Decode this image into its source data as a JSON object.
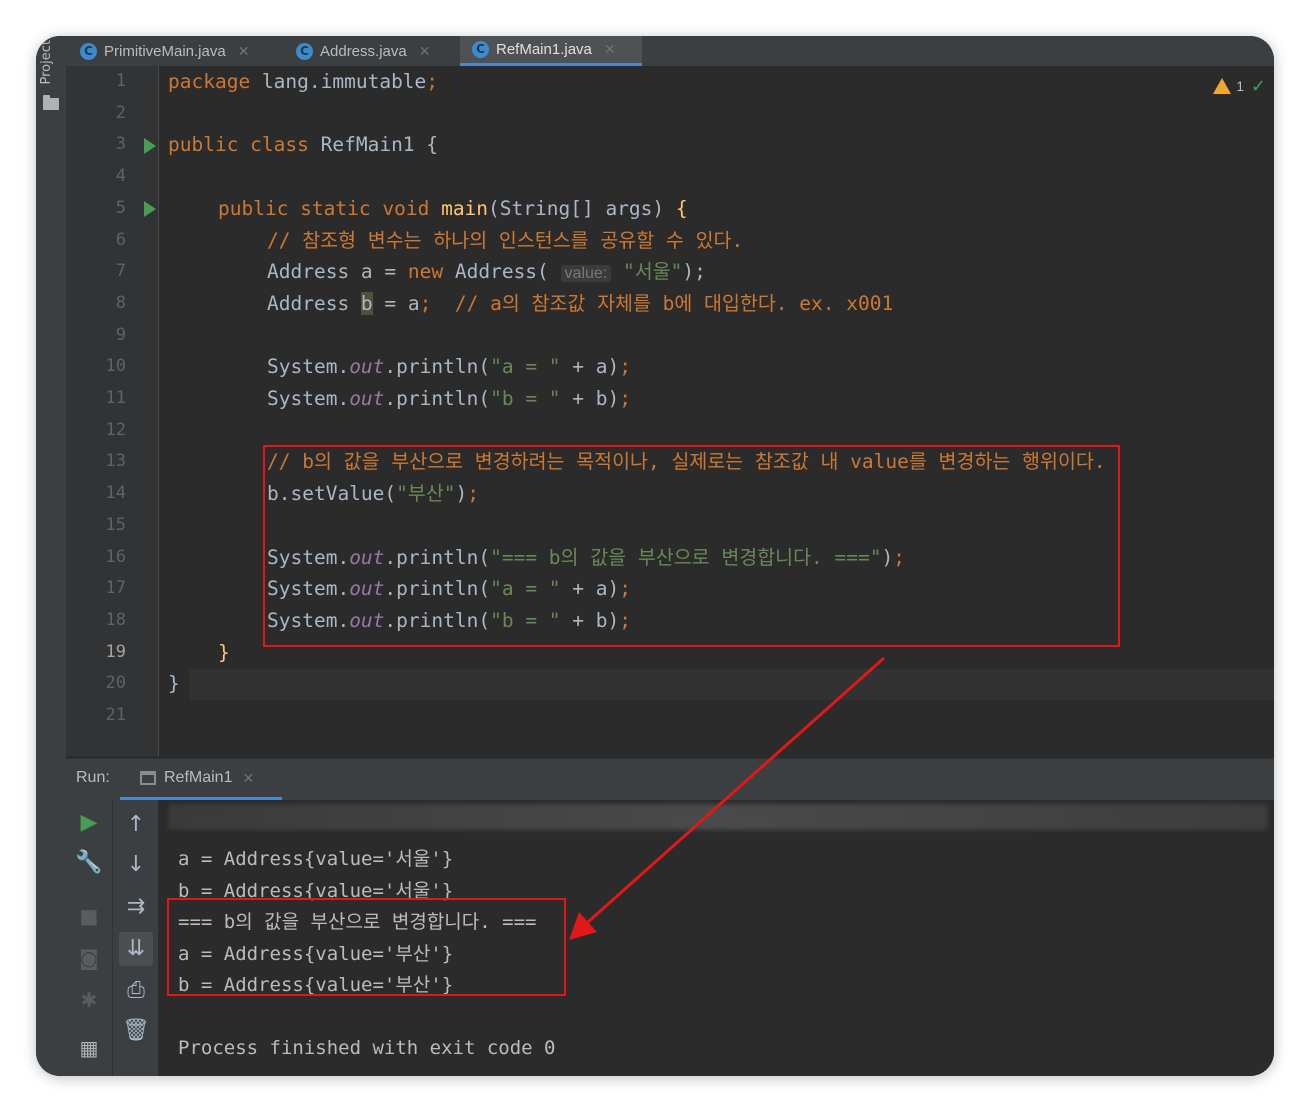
{
  "tabs": [
    {
      "label": "PrimitiveMain.java",
      "active": false
    },
    {
      "label": "Address.java",
      "active": false
    },
    {
      "label": "RefMain1.java",
      "active": true
    }
  ],
  "project_label": "Project",
  "inspection": {
    "warnings": "1"
  },
  "line_numbers": [
    "1",
    "2",
    "3",
    "4",
    "5",
    "6",
    "7",
    "8",
    "9",
    "10",
    "11",
    "12",
    "13",
    "14",
    "15",
    "16",
    "17",
    "18",
    "19",
    "20",
    "21"
  ],
  "current_line": "19",
  "code": {
    "l1_kw": "package",
    "l1_rest": " lang.immutable",
    "l1_semi": ";",
    "l3_kw": "public class",
    "l3_rest": " RefMain1 {",
    "l5_kw": "public static void",
    "l5_fn": "main",
    "l5_args": "(String[] args) ",
    "l5_brace": "{",
    "l6_comment": "// 참조형 변수는 하나의 인스턴스를 공유할 수 있다.",
    "l7_a": "Address a = ",
    "l7_new": "new",
    "l7_b": " Address(",
    "l7_hint": "value:",
    "l7_str": "\"서울\"",
    "l7_c": ");",
    "l8_a": "Address ",
    "l8_b": "b",
    "l8_c": " = a",
    "l8_semi": ";",
    "l8_comment": "  // a의 참조값 자체를 b에 대입한다. ex. x001",
    "l10_a": "System.",
    "l10_out": "out",
    "l10_b": ".println(",
    "l10_str": "\"a = \"",
    "l10_c": " + a)",
    "l10_semi": ";",
    "l11_a": "System.",
    "l11_out": "out",
    "l11_b": ".println(",
    "l11_str": "\"b = \"",
    "l11_c": " + b)",
    "l11_semi": ";",
    "l13_comment": "// b의 값을 부산으로 변경하려는 목적이나, 실제로는 참조값 내 value를 변경하는 행위이다.",
    "l14_a": "b.setValue(",
    "l14_str": "\"부산\"",
    "l14_c": ")",
    "l14_semi": ";",
    "l16_a": "System.",
    "l16_out": "out",
    "l16_b": ".println(",
    "l16_str": "\"=== b의 값을 부산으로 변경합니다. ===\"",
    "l16_c": ")",
    "l16_semi": ";",
    "l17_a": "System.",
    "l17_out": "out",
    "l17_b": ".println(",
    "l17_str": "\"a = \"",
    "l17_c": " + a)",
    "l17_semi": ";",
    "l18_a": "System.",
    "l18_out": "out",
    "l18_b": ".println(",
    "l18_str": "\"b = \"",
    "l18_c": " + b)",
    "l18_semi": ";",
    "l19": "}",
    "l20": "}"
  },
  "run": {
    "label": "Run:",
    "tab": "RefMain1",
    "output": [
      "a = Address{value='서울'}",
      "b = Address{value='서울'}",
      "=== b의 값을 부산으로 변경합니다. ===",
      "a = Address{value='부산'}",
      "b = Address{value='부산'}",
      "",
      "Process finished with exit code 0"
    ]
  },
  "colors": {
    "annotation": "#e01818",
    "keyword": "#cc7832",
    "string": "#6a8759",
    "accent": "#4a88c7"
  }
}
